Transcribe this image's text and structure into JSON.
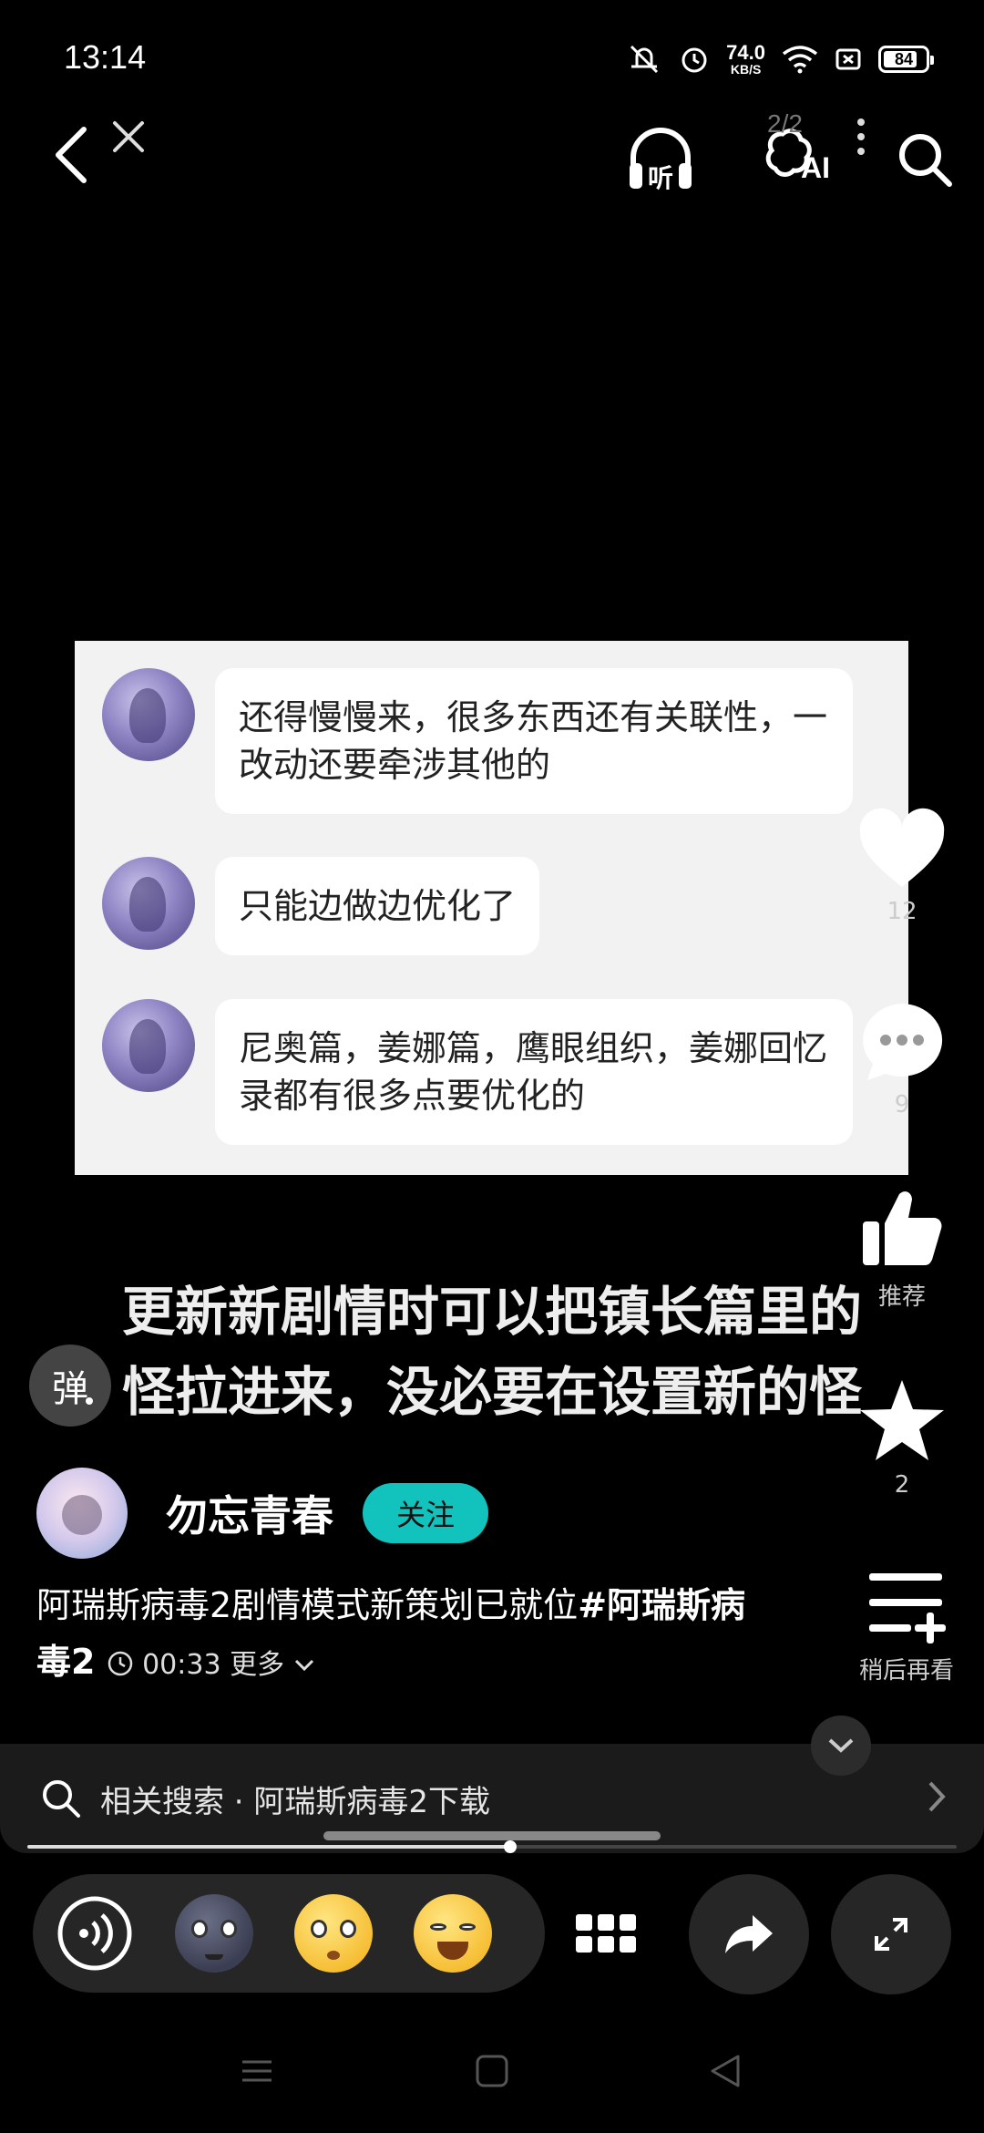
{
  "status_bar": {
    "time": "13:14",
    "net_speed_value": "74.0",
    "net_speed_unit": "KB/S",
    "battery": "84",
    "battery_fraction": 0.84
  },
  "top_nav": {
    "ai_count": "2/2",
    "listen_icon": "headphones-listen-icon",
    "ai_label": "AI"
  },
  "chat": {
    "messages": [
      {
        "text": "还得慢慢来，很多东西还有关联性，一改动还要牵涉其他的"
      },
      {
        "text": "只能边做边优化了"
      },
      {
        "text": "尼奥篇，姜娜篇，鹰眼组织，姜娜回忆录都有很多点要优化的"
      }
    ]
  },
  "subtitle": {
    "line1": "更新新剧情时可以把镇长篇里的",
    "line2": "怪拉进来，没必要在设置新的怪"
  },
  "danmaku": {
    "label": "弹"
  },
  "actions": {
    "like_count": "12",
    "comment_count": "9",
    "recommend_label": "推荐",
    "favorite_count": "2",
    "watch_later_label": "稍后再看"
  },
  "author": {
    "name": "勿忘青春",
    "follow_label": "关注"
  },
  "description": {
    "text": "阿瑞斯病毒2剧情模式新策划已就位",
    "tag": "#阿瑞斯病毒2",
    "duration": "00:33",
    "more_label": "更多"
  },
  "related_search": {
    "text": "相关搜索 · 阿瑞斯病毒2下载"
  },
  "progress": {
    "fraction": 0.52
  },
  "colors": {
    "follow_accent": "#11c2bd",
    "background": "#000000"
  }
}
